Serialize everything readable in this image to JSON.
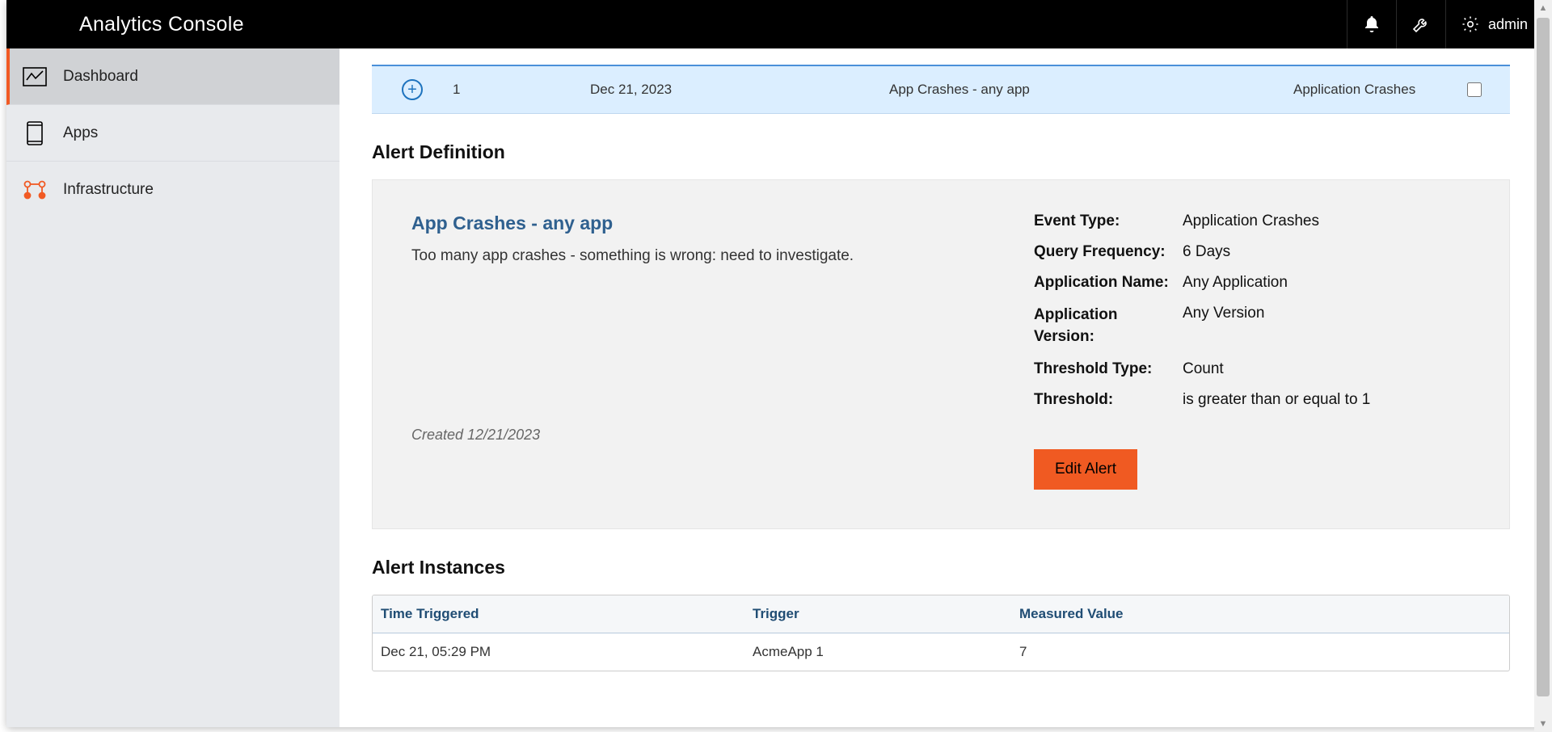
{
  "header": {
    "title": "Analytics Console",
    "user_label": "admin"
  },
  "sidebar": {
    "items": [
      {
        "label": "Dashboard",
        "active": true
      },
      {
        "label": "Apps",
        "active": false
      },
      {
        "label": "Infrastructure",
        "active": false
      }
    ]
  },
  "alerts_summary_row": {
    "count": "1",
    "date": "Dec 21, 2023",
    "name": "App Crashes - any app",
    "event_type": "Application Crashes"
  },
  "def_title": "Alert Definition",
  "definition": {
    "name": "App Crashes - any app",
    "description": "Too many app crashes - something is wrong: need to investigate.",
    "created": "Created 12/21/2023",
    "fields": {
      "event_type_label": "Event Type:",
      "event_type_value": "Application Crashes",
      "freq_label": "Query Frequency:",
      "freq_value": "6 Days",
      "appname_label": "Application Name:",
      "appname_value": "Any Application",
      "appver_label": "Application Version:",
      "appver_value": "Any Version",
      "thtype_label": "Threshold Type:",
      "thtype_value": "Count",
      "th_label": "Threshold:",
      "th_value": "is greater than or equal to 1"
    },
    "edit_label": "Edit Alert"
  },
  "instances_title": "Alert Instances",
  "instances": {
    "headers": {
      "time": "Time Triggered",
      "trigger": "Trigger",
      "value": "Measured Value"
    },
    "rows": [
      {
        "time": "Dec 21, 05:29 PM",
        "trigger": "AcmeApp 1",
        "value": "7"
      }
    ]
  }
}
